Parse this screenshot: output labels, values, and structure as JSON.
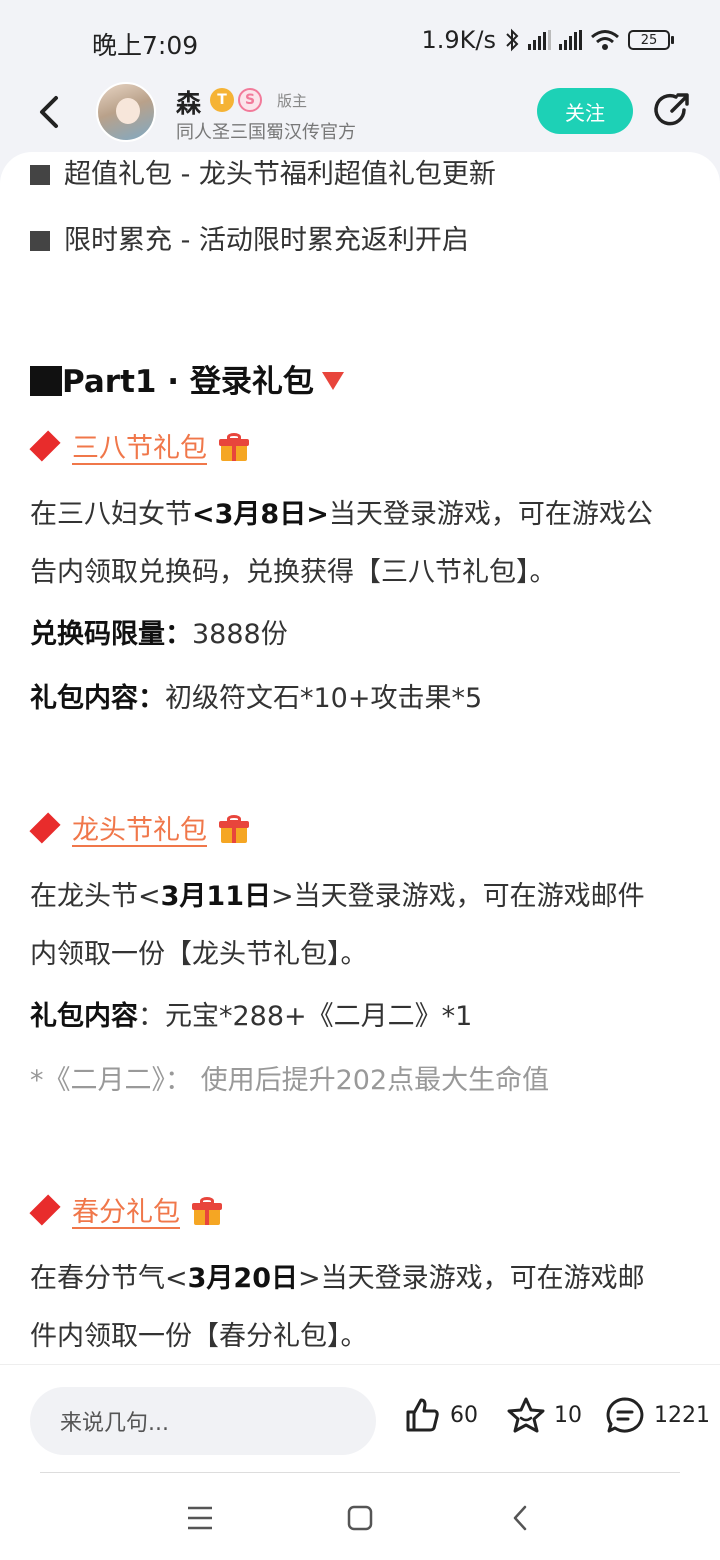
{
  "status_bar": {
    "time": "晚上7:09",
    "speed": "1.9K/s",
    "battery": "25"
  },
  "header": {
    "user_name": "森",
    "badge_t": "T",
    "badge_s": "S",
    "role": "版主",
    "subtitle": "同人圣三国蜀汉传官方",
    "follow_label": "关注"
  },
  "content": {
    "bullet1": "超值礼包 - 龙头节福利超值礼包更新",
    "bullet2": "限时累充 - 活动限时累充返利开启",
    "part_heading": "Part1 · 登录礼包",
    "gift1": {
      "title": "三八节礼包",
      "desc1_pre": "在三八妇女节",
      "desc1_date": "<3月8日>",
      "desc1_post": "当天登录游戏，可在游戏公",
      "desc2": "告内领取兑换码，兑换获得【三八节礼包】。",
      "limit_label": "兑换码限量：",
      "limit_value": "3888份",
      "content_label": "礼包内容：",
      "content_value": "初级符文石*10+攻击果*5"
    },
    "gift2": {
      "title": "龙头节礼包",
      "desc1_pre": "在龙头节<",
      "desc1_date": "3月11日",
      "desc1_post": ">当天登录游戏，可在游戏邮件",
      "desc2": "内领取一份【龙头节礼包】。",
      "content_label": "礼包内容",
      "content_value": "：元宝*288+《二月二》*1",
      "note": "*《二月二》： 使用后提升202点最大生命值"
    },
    "gift3": {
      "title": "春分礼包",
      "desc1_pre": "在春分节气<",
      "desc1_date": "3月20日",
      "desc1_post": ">当天登录游戏，可在游戏邮",
      "desc2": "件内领取一份【春分礼包】。"
    }
  },
  "bottom_bar": {
    "comment_placeholder": "来说几句...",
    "likes": "60",
    "favorites": "10",
    "comments": "1221"
  },
  "colors": {
    "accent": "#1dd1b6",
    "link": "#f0774a",
    "diamond": "#e82c2c"
  }
}
